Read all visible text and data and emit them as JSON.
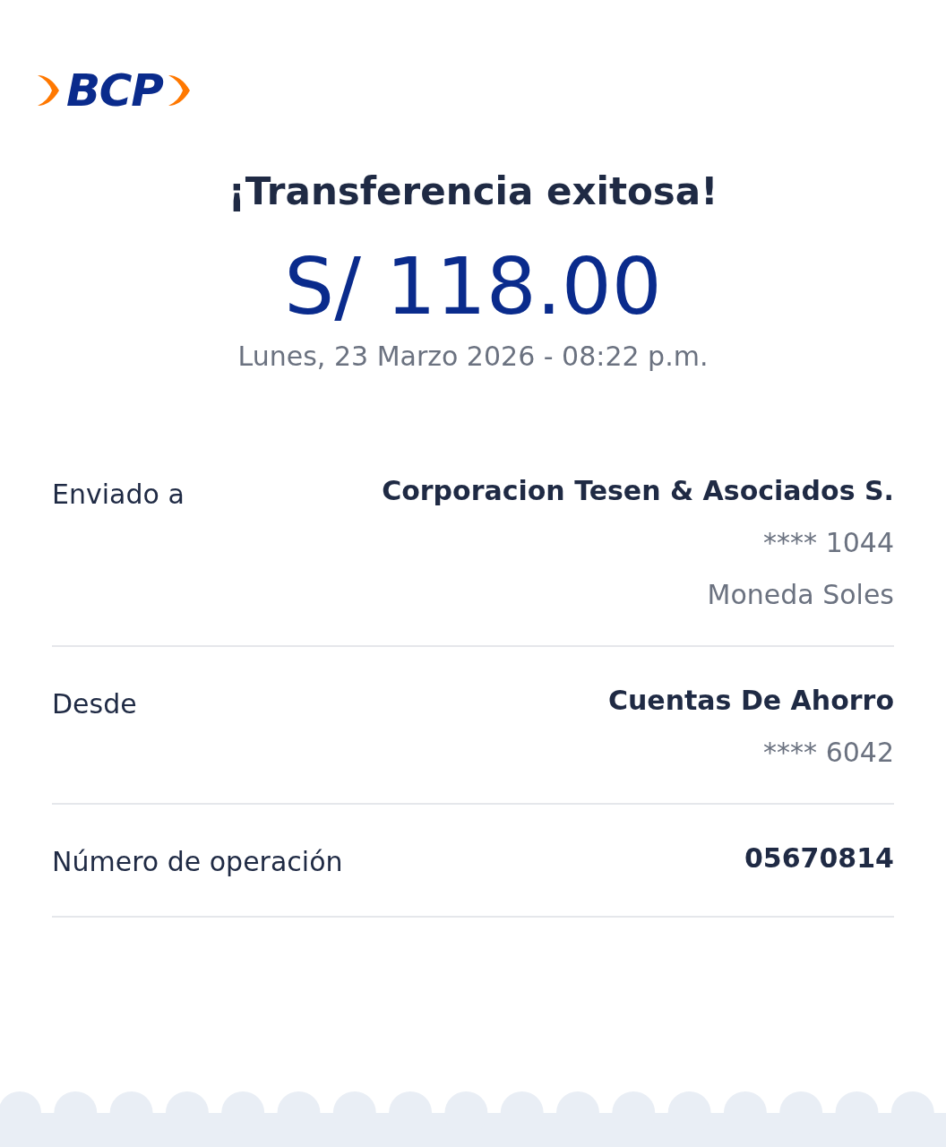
{
  "logo": {
    "text": "BCP"
  },
  "title": "¡Transferencia exitosa!",
  "amount": "S/ 118.00",
  "datetime": "Lunes, 23 Marzo 2026 - 08:22 p.m.",
  "details": [
    {
      "label": "Enviado a",
      "lines": [
        {
          "text": "Corporacion Tesen & Asociados S.",
          "kind": "primary"
        },
        {
          "text": "**** 1044",
          "kind": "secondary"
        },
        {
          "text": "Moneda Soles",
          "kind": "secondary"
        }
      ]
    },
    {
      "label": "Desde",
      "lines": [
        {
          "text": "Cuentas De Ahorro",
          "kind": "primary"
        },
        {
          "text": "**** 6042",
          "kind": "secondary"
        }
      ]
    },
    {
      "label": "Número de operación",
      "lines": [
        {
          "text": "05670814",
          "kind": "primary"
        }
      ]
    }
  ]
}
